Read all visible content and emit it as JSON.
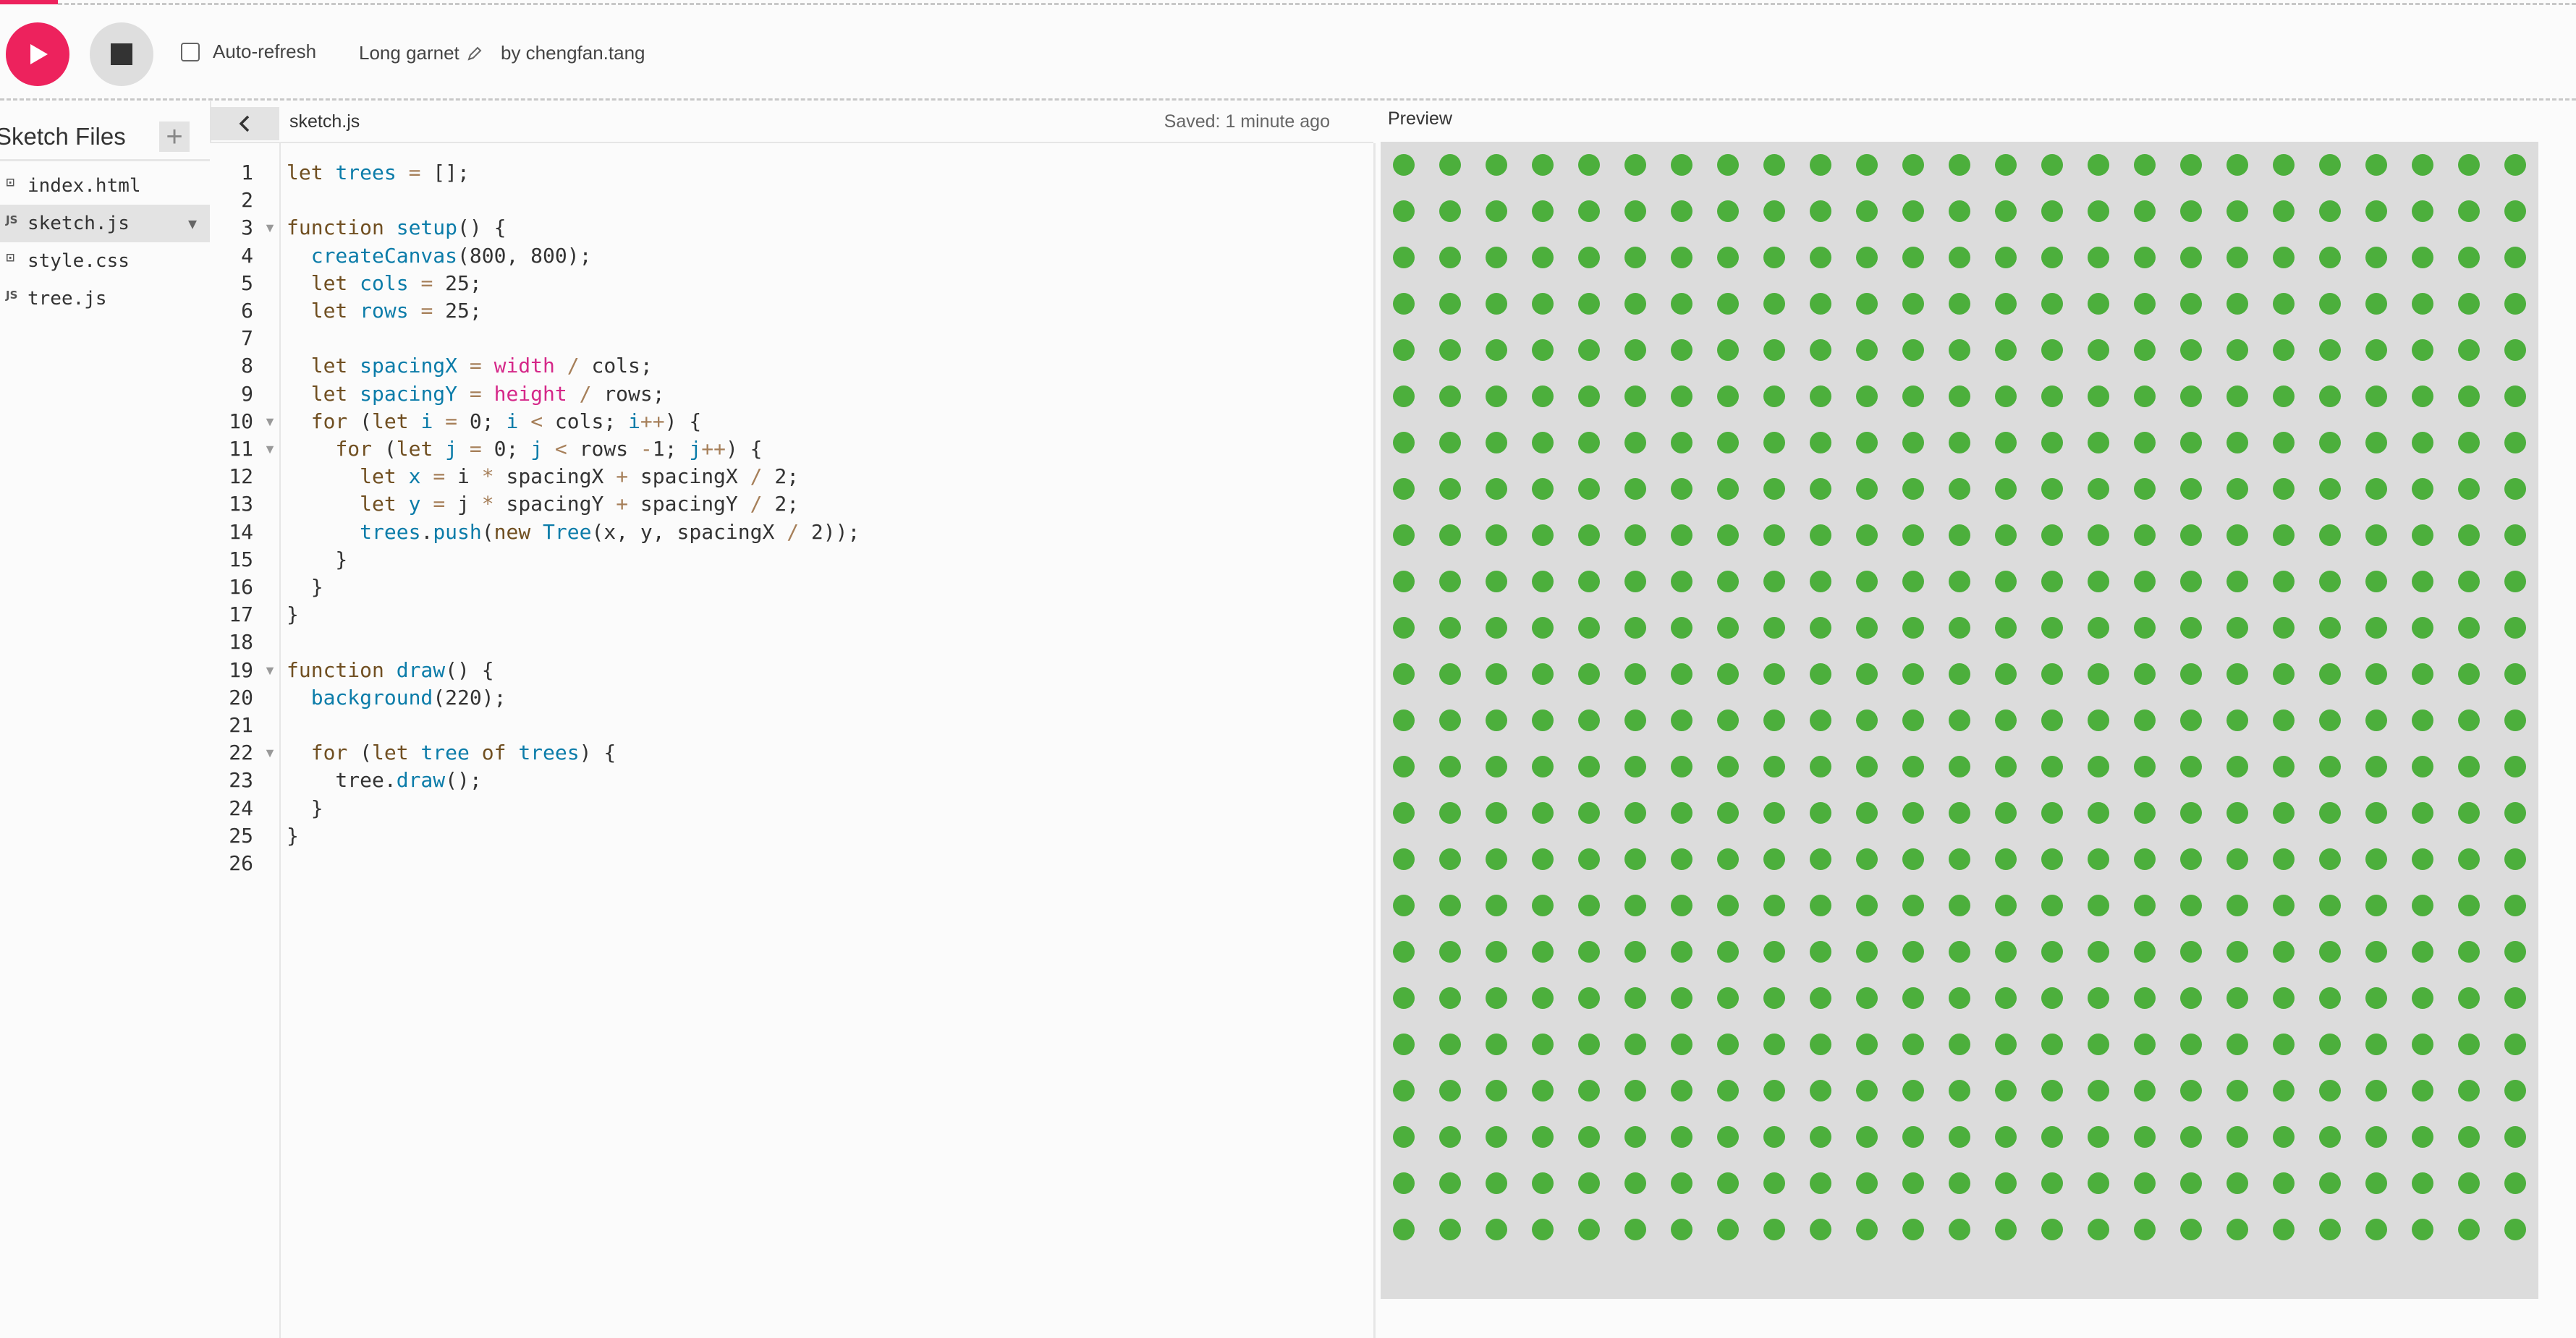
{
  "toolbar": {
    "auto_refresh_label": "Auto-refresh",
    "auto_refresh_checked": false,
    "project_name": "Long garnet",
    "byline": "by chengfan.tang"
  },
  "sidebar": {
    "title": "Sketch Files",
    "files": [
      {
        "icon": "html-file-icon",
        "badge": "⊡",
        "name": "index.html",
        "selected": false
      },
      {
        "icon": "js-file-icon",
        "badge": "JS",
        "name": "sketch.js",
        "selected": true
      },
      {
        "icon": "css-file-icon",
        "badge": "⊡",
        "name": "style.css",
        "selected": false
      },
      {
        "icon": "js-file-icon",
        "badge": "JS",
        "name": "tree.js",
        "selected": false
      }
    ]
  },
  "editor": {
    "file_tab": "sketch.js",
    "saved_status": "Saved: 1 minute ago",
    "folded_lines": [
      3,
      10,
      11,
      19,
      22
    ],
    "lines": [
      "let trees = [];",
      "",
      "function setup() {",
      "  createCanvas(800, 800);",
      "  let cols = 25;",
      "  let rows = 25;",
      "",
      "  let spacingX = width / cols;",
      "  let spacingY = height / rows;",
      "  for (let i = 0; i < cols; i++) {",
      "    for (let j = 0; j < rows -1; j++) {",
      "      let x = i * spacingX + spacingX / 2;",
      "      let y = j * spacingY + spacingY / 2;",
      "      trees.push(new Tree(x, y, spacingX / 2));",
      "    }",
      "  }",
      "}",
      "",
      "function draw() {",
      "  background(220);",
      "",
      "  for (let tree of trees) {",
      "    tree.draw();",
      "  }",
      "}",
      ""
    ]
  },
  "preview": {
    "label": "Preview",
    "background": "#dcdcdc",
    "dot_color": "#4caf3c",
    "cols": 25,
    "rows": 24
  },
  "colors": {
    "accent": "#ed225d",
    "keyword": "#704f21",
    "variable": "#0b7ca9",
    "builtin": "#d52889"
  }
}
